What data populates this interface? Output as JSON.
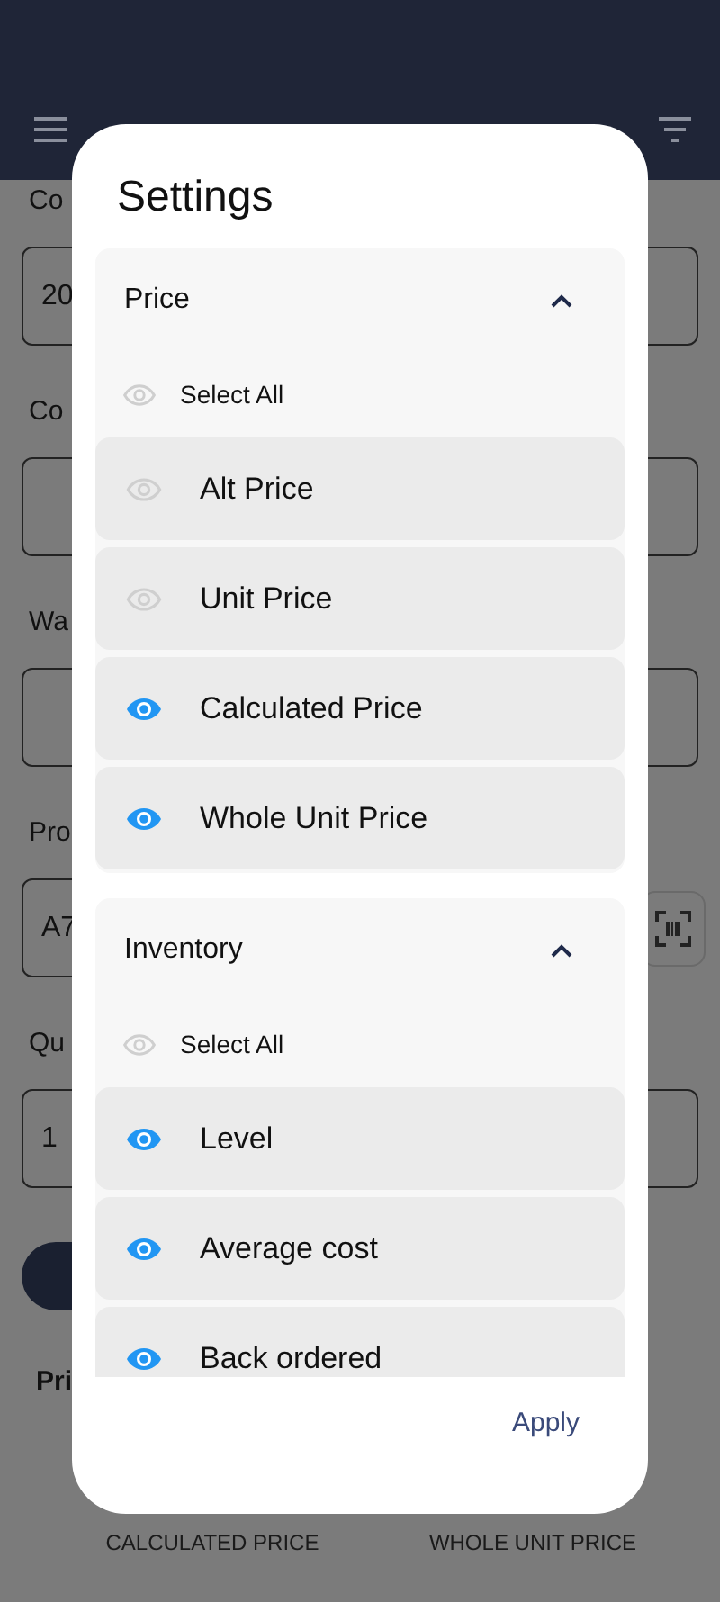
{
  "background": {
    "fields": [
      {
        "label": "Co",
        "value": "20",
        "kind": "text"
      },
      {
        "label": "Co",
        "kind": "text"
      },
      {
        "label": "Wa",
        "kind": "text"
      },
      {
        "label": "Pro",
        "value": "A7",
        "kind": "scan"
      },
      {
        "label": "Qu",
        "value": "1",
        "kind": "text"
      }
    ],
    "section_label": "Pri",
    "summary": [
      {
        "caption": "CALCULATED PRICE"
      },
      {
        "caption": "WHOLE UNIT PRICE"
      }
    ]
  },
  "settings": {
    "title": "Settings",
    "sections": [
      {
        "title": "Price",
        "expanded": true,
        "select_all": {
          "label": "Select All",
          "visible": false
        },
        "items": [
          {
            "label": "Alt Price",
            "visible": false
          },
          {
            "label": "Unit Price",
            "visible": false
          },
          {
            "label": "Calculated Price",
            "visible": true
          },
          {
            "label": "Whole Unit Price",
            "visible": true
          }
        ]
      },
      {
        "title": "Inventory",
        "expanded": true,
        "select_all": {
          "label": "Select All",
          "visible": false
        },
        "items": [
          {
            "label": "Level",
            "visible": true
          },
          {
            "label": "Average cost",
            "visible": true
          },
          {
            "label": "Back ordered",
            "visible": true
          }
        ]
      }
    ],
    "apply": "Apply"
  }
}
